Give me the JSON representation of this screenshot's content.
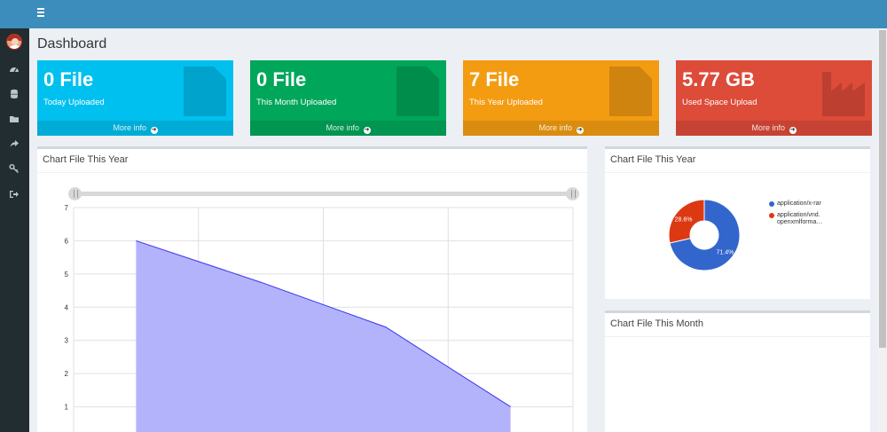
{
  "header": {
    "menu_icon": "hamburger-icon"
  },
  "sidebar": {
    "avatar": "user-avatar",
    "items": [
      {
        "icon": "dashboard-icon"
      },
      {
        "icon": "database-icon"
      },
      {
        "icon": "folder-icon"
      },
      {
        "icon": "share-icon"
      },
      {
        "icon": "key-icon"
      },
      {
        "icon": "sign-out-icon"
      }
    ]
  },
  "page": {
    "title": "Dashboard"
  },
  "stats": [
    {
      "value": "0 File",
      "label": "Today Uploaded",
      "more": "More info",
      "color": "#00c0ef",
      "icon": "file-icon"
    },
    {
      "value": "0 File",
      "label": "This Month Uploaded",
      "more": "More info",
      "color": "#00a65a",
      "icon": "file-icon"
    },
    {
      "value": "7 File",
      "label": "This Year Uploaded",
      "more": "More info",
      "color": "#f39c12",
      "icon": "file-icon"
    },
    {
      "value": "5.77 GB",
      "label": "Used Space Upload",
      "more": "More info",
      "color": "#dd4b39",
      "icon": "industry-icon"
    }
  ],
  "panels": {
    "year_area_title": "Chart File This Year",
    "year_pie_title": "Chart File This Year",
    "month_title": "Chart File This Month"
  },
  "chart_data": [
    {
      "type": "area",
      "title": "",
      "x": [
        1,
        2,
        3,
        4
      ],
      "y": [
        6,
        4.75,
        3.4,
        1
      ],
      "ylim": [
        0,
        7
      ],
      "yticks": [
        "1",
        "2",
        "3",
        "4",
        "5",
        "6",
        "7"
      ],
      "grid": true,
      "fill_color": "#b3b3fc",
      "line_color": "#3333ee"
    },
    {
      "type": "pie",
      "title": "",
      "slices": [
        {
          "name": "application/x-rar",
          "value": 71.4,
          "label": "71.4%",
          "color": "#3366cc"
        },
        {
          "name": "application/vnd.openxmlforma…",
          "value": 28.6,
          "label": "28.6%",
          "color": "#dc3912"
        }
      ],
      "legend_labels": [
        "application/x-rar",
        "application/vnd.",
        "openxmlforma…"
      ],
      "legend": "right"
    }
  ]
}
